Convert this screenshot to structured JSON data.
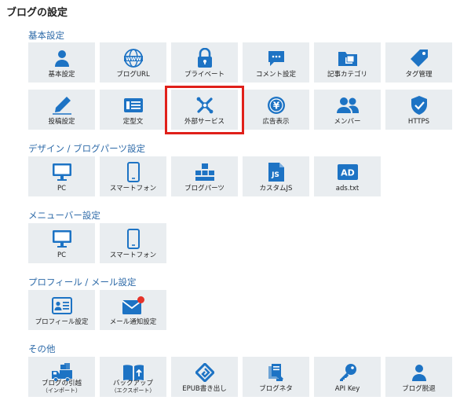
{
  "page_title": "ブログの設定",
  "accent_color": "#1d73c4",
  "sections": {
    "basic": {
      "title": "基本設定",
      "items": [
        {
          "label": "基本設定",
          "icon": "person-icon"
        },
        {
          "label": "ブログURL",
          "icon": "globe-www-icon"
        },
        {
          "label": "プライベート",
          "icon": "lock-icon"
        },
        {
          "label": "コメント設定",
          "icon": "comment-icon"
        },
        {
          "label": "記事カテゴリ",
          "icon": "folder-icon"
        },
        {
          "label": "タグ管理",
          "icon": "tag-icon"
        },
        {
          "label": "投稿設定",
          "icon": "pencil-icon"
        },
        {
          "label": "定型文",
          "icon": "template-icon"
        },
        {
          "label": "外部サービス",
          "icon": "external-services-icon"
        },
        {
          "label": "広告表示",
          "icon": "yen-coin-icon"
        },
        {
          "label": "メンバー",
          "icon": "members-icon"
        },
        {
          "label": "HTTPS",
          "icon": "shield-check-icon"
        }
      ]
    },
    "design": {
      "title": "デザイン / ブログパーツ設定",
      "items": [
        {
          "label": "PC",
          "icon": "monitor-icon"
        },
        {
          "label": "スマートフォン",
          "icon": "smartphone-icon"
        },
        {
          "label": "ブログパーツ",
          "icon": "blog-parts-icon"
        },
        {
          "label": "カスタムJS",
          "icon": "js-file-icon"
        },
        {
          "label": "ads.txt",
          "icon": "ad-icon"
        }
      ]
    },
    "menubar": {
      "title": "メニューバー設定",
      "items": [
        {
          "label": "PC",
          "icon": "monitor-icon"
        },
        {
          "label": "スマートフォン",
          "icon": "smartphone-icon"
        }
      ]
    },
    "profile": {
      "title": "プロフィール / メール設定",
      "items": [
        {
          "label": "プロフィール設定",
          "icon": "profile-card-icon"
        },
        {
          "label": "メール通知設定",
          "icon": "mail-notification-icon"
        }
      ]
    },
    "other": {
      "title": "その他",
      "items": [
        {
          "label": "ブログの引越",
          "sub": "（インポート）",
          "icon": "moving-truck-icon"
        },
        {
          "label": "バックアップ",
          "sub": "（エクスポート）",
          "icon": "backup-book-icon"
        },
        {
          "label": "EPUB書き出し",
          "icon": "epub-icon"
        },
        {
          "label": "ブログネタ",
          "icon": "blog-topics-icon"
        },
        {
          "label": "API Key",
          "icon": "key-icon"
        },
        {
          "label": "ブログ脱退",
          "icon": "leave-person-icon"
        }
      ]
    }
  }
}
